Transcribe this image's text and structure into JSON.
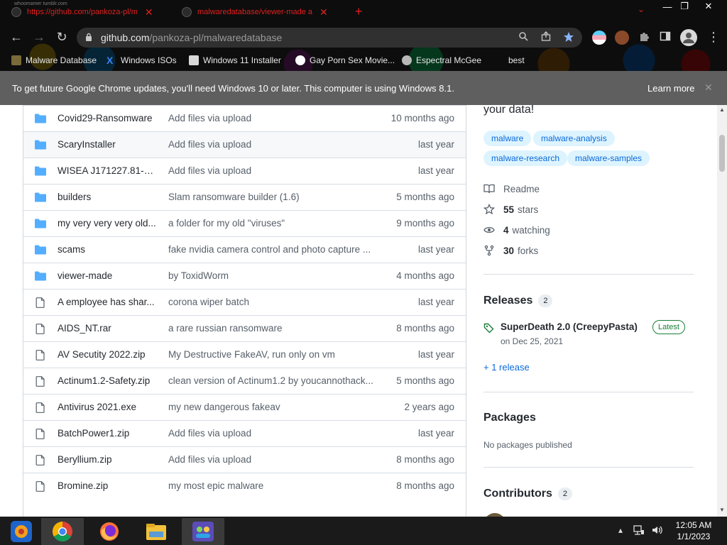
{
  "browser": {
    "tiny_text": "whoomamer tumblr.com",
    "tabs": [
      {
        "title": "https://github.com/pankoza-pl/m",
        "close": "✕"
      },
      {
        "title": "malwaredatabase/viewer-made a",
        "close": "✕"
      }
    ],
    "new_tab": "+",
    "tab_search": "⌄",
    "window_controls": {
      "minimize": "—",
      "restore": "❐",
      "close": "✕"
    },
    "nav": {
      "back": "←",
      "forward": "→",
      "reload": "↻"
    },
    "address": {
      "host": "github.com",
      "path": "/pankoza-pl/malwaredatabase"
    },
    "menu": "⋮",
    "bookmarks": [
      {
        "label": "Malware Database",
        "icon": "man-icon"
      },
      {
        "label": "Windows ISOs",
        "icon": "x-icon"
      },
      {
        "label": "Windows 11 Installer",
        "icon": "page-icon"
      },
      {
        "label": "Gay Porn Sex Movie...",
        "icon": "globe-icon"
      },
      {
        "label": "Espectral McGee",
        "icon": "skull-icon"
      },
      {
        "label": "best",
        "icon": "none"
      }
    ],
    "infobar": {
      "message": "To get future Google Chrome updates, you'll need Windows 10 or later. This computer is using Windows 8.1.",
      "action": "Learn more",
      "close": "✕"
    }
  },
  "files": [
    {
      "type": "folder",
      "name": "Covid29-Ransomware",
      "message": "Add files via upload",
      "age": "10 months ago"
    },
    {
      "type": "folder",
      "name": "ScaryInstaller",
      "message": "Add files via upload",
      "age": "last year"
    },
    {
      "type": "folder",
      "name": "WISEA J171227.81-23...",
      "message": "Add files via upload",
      "age": "last year"
    },
    {
      "type": "folder",
      "name": "builders",
      "message": "Slam ransomware builder (1.6)",
      "age": "5 months ago"
    },
    {
      "type": "folder",
      "name": "my very very very old...",
      "message": "a folder for my old \"viruses\"",
      "age": "9 months ago"
    },
    {
      "type": "folder",
      "name": "scams",
      "message": "fake nvidia camera control and photo capture ...",
      "age": "last year"
    },
    {
      "type": "folder",
      "name": "viewer-made",
      "message": "by ToxidWorm",
      "age": "4 months ago"
    },
    {
      "type": "file",
      "name": "A employee has shar...",
      "message": "corona wiper batch",
      "age": "last year"
    },
    {
      "type": "file",
      "name": "AIDS_NT.rar",
      "message": "a rare russian ransomware",
      "age": "8 months ago"
    },
    {
      "type": "file",
      "name": "AV Secutity 2022.zip",
      "message": "My Destructive FakeAV, run only on vm",
      "age": "last year"
    },
    {
      "type": "file",
      "name": "Actinum1.2-Safety.zip",
      "message": "clean version of Actinum1.2 by youcannothack...",
      "age": "5 months ago"
    },
    {
      "type": "file",
      "name": "Antivirus 2021.exe",
      "message": "my new dangerous fakeav",
      "age": "2 years ago"
    },
    {
      "type": "file",
      "name": "BatchPower1.zip",
      "message": "Add files via upload",
      "age": "last year"
    },
    {
      "type": "file",
      "name": "Beryllium.zip",
      "message": "Add files via upload",
      "age": "8 months ago"
    },
    {
      "type": "file",
      "name": "Bromine.zip",
      "message": "my most epic malware",
      "age": "8 months ago"
    }
  ],
  "sidebar": {
    "about_tail": "your data!",
    "topics": [
      "malware",
      "malware-analysis",
      "malware-research",
      "malware-samples"
    ],
    "readme": "Readme",
    "stars_count": "55",
    "stars_label": "stars",
    "watching_count": "4",
    "watching_label": "watching",
    "forks_count": "30",
    "forks_label": "forks",
    "releases": {
      "heading": "Releases",
      "count": "2",
      "latest_title": "SuperDeath 2.0 (CreepyPasta)",
      "latest_badge": "Latest",
      "latest_date": "on Dec 25, 2021",
      "more_link": "+ 1 release"
    },
    "packages": {
      "heading": "Packages",
      "empty": "No packages published"
    },
    "contributors": {
      "heading": "Contributors",
      "count": "2"
    }
  },
  "taskbar": {
    "apps": [
      "media-player-icon",
      "chrome-icon",
      "firefox-icon",
      "file-explorer-icon",
      "people-app-icon"
    ],
    "tray": {
      "chevron": "▴",
      "network": "🖧",
      "volume": "🔊"
    },
    "time": "12:05 AM",
    "date": "1/1/2023"
  },
  "colors": {
    "link": "#0969da",
    "topic_bg": "#ddf4ff",
    "folder": "#54aeff",
    "latest": "#1a7f37",
    "infobar": "#5f5f5f"
  }
}
